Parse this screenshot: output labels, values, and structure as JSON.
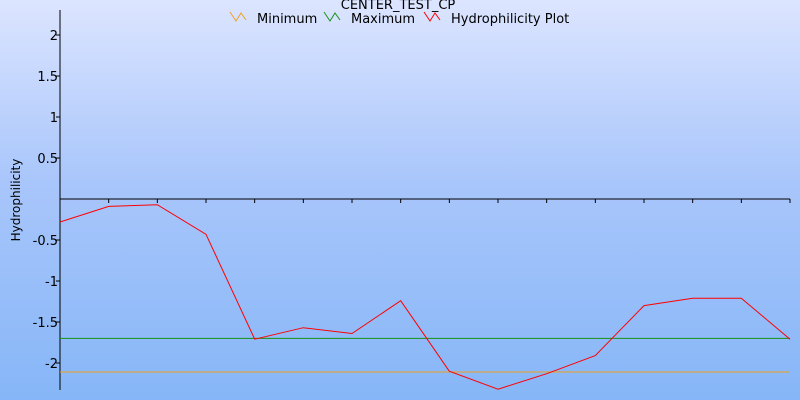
{
  "chart_data": {
    "type": "line",
    "title": "CENTER_TEST_CP",
    "ylabel": "Hydrophilicity",
    "xlabel": "",
    "ylim": [
      -2.32,
      2.32
    ],
    "y_ticks": [
      {
        "value": 2,
        "label": "2"
      },
      {
        "value": 1.5,
        "label": "1.5"
      },
      {
        "value": 1,
        "label": "1"
      },
      {
        "value": 0.5,
        "label": "0.5"
      },
      {
        "value": -0.5,
        "label": "-0.5"
      },
      {
        "value": -1,
        "label": "-1"
      },
      {
        "value": -1.5,
        "label": "-1.5"
      },
      {
        "value": -2,
        "label": "-2"
      }
    ],
    "x_count": 16,
    "series": [
      {
        "name": "Minimum",
        "color": "#f0a020",
        "values": [
          -2.11,
          -2.11,
          -2.11,
          -2.11,
          -2.11,
          -2.11,
          -2.11,
          -2.11,
          -2.11,
          -2.11,
          -2.11,
          -2.11,
          -2.11,
          -2.11,
          -2.11,
          -2.11
        ]
      },
      {
        "name": "Maximum",
        "color": "#159015",
        "values": [
          -1.7,
          -1.7,
          -1.7,
          -1.7,
          -1.7,
          -1.7,
          -1.7,
          -1.7,
          -1.7,
          -1.7,
          -1.7,
          -1.7,
          -1.7,
          -1.7,
          -1.7,
          -1.7
        ]
      },
      {
        "name": "Hydrophilicity Plot",
        "color": "#ff0000",
        "values": [
          -0.28,
          -0.09,
          -0.07,
          -0.43,
          -1.71,
          -1.57,
          -1.64,
          -1.24,
          -2.1,
          -2.32,
          -2.13,
          -1.91,
          -1.3,
          -1.21,
          -1.21,
          -1.71
        ]
      }
    ],
    "grid": false,
    "legend_position": "top"
  }
}
